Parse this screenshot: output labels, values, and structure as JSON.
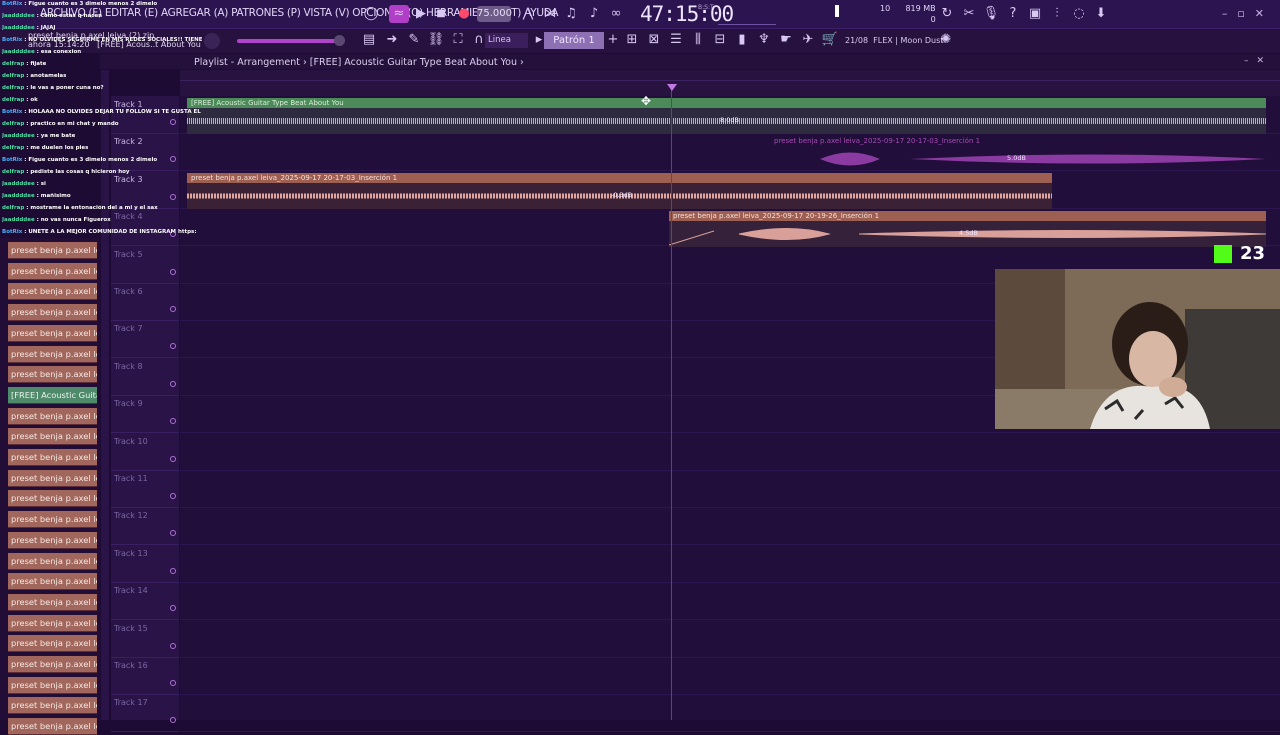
{
  "menu_text": "ARCHIVO (F) EDITAR (E) AGREGAR (A) PATRONES (P) VISTA (V) OPCIONES (O) HERRAMIENTAS (T) AYUDA",
  "tempo": "75.000",
  "time_display": "47:15:00",
  "time_small": "B:S:T",
  "memory": {
    "line1": "10",
    "mb": "819 MB",
    "line2": "0"
  },
  "file_info": {
    "name": "preset benja p.axel leiva (2).zip",
    "time": "ahora 15:14:20",
    "label": "[FREE] Acous..t About You"
  },
  "snap_mode": "Linea",
  "pattern": "Patrón 1",
  "plugin_info": {
    "num": "21/08",
    "name": "FLEX | Moon Dust"
  },
  "playlist_title": "Playlist - Arrangement",
  "playlist_song": "[FREE] Acoustic Guitar Type Beat About You",
  "chat": [
    {
      "user": "BotRix",
      "bot": true,
      "text": "Figue cuanto es 3 dimelo menos 2 dimelo"
    },
    {
      "user": "Jaaddddee",
      "bot": false,
      "text": "como estas q hacen"
    },
    {
      "user": "Jaaddddee",
      "bot": false,
      "text": "JAJAJ"
    },
    {
      "user": "BotRix",
      "bot": true,
      "text": "NO OLVIDES SEGUIRME EN MIS REDES SOCIALES!! TIENE"
    },
    {
      "user": "Jaaddddee",
      "bot": false,
      "text": "esa conexion"
    },
    {
      "user": "delfrap",
      "bot": false,
      "text": "fijate"
    },
    {
      "user": "delfrap",
      "bot": false,
      "text": "anotamelas"
    },
    {
      "user": "delfrap",
      "bot": false,
      "text": "le vas a poner cuna no?"
    },
    {
      "user": "delfrap",
      "bot": false,
      "text": "ok"
    },
    {
      "user": "BotRix",
      "bot": true,
      "text": "HOLAAA NO OLVIDES DEJAR TU FOLLOW SI TE GUSTA EL"
    },
    {
      "user": "delfrap",
      "bot": false,
      "text": "practico en mi chat y mando"
    },
    {
      "user": "Jaaddddee",
      "bot": false,
      "text": "ya me bate"
    },
    {
      "user": "delfrap",
      "bot": false,
      "text": "me duelen los pies"
    },
    {
      "user": "BotRix",
      "bot": true,
      "text": "Figue cuanto es 3 dimelo menos 2 dimelo"
    },
    {
      "user": "delfrap",
      "bot": false,
      "text": "pediste las cosas q hicieron hoy"
    },
    {
      "user": "Jaaddddee",
      "bot": false,
      "text": "si"
    },
    {
      "user": "Jaaddddee",
      "bot": false,
      "text": "mañisimo"
    },
    {
      "user": "delfrap",
      "bot": false,
      "text": "mostrame la entonación del a mi y el sax"
    },
    {
      "user": "Jaaddddee",
      "bot": false,
      "text": "no vas nunca Figuerox"
    },
    {
      "user": "BotRix",
      "bot": true,
      "text": "UNETE A LA MEJOR COMUNIDAD DE INSTAGRAM https:"
    }
  ],
  "browser_items": [
    "preset benja p.axel leiva_",
    "preset benja p.axel leiva_",
    "preset benja p.axel leiva_",
    "preset benja p.axel leiva_",
    "preset benja p.axel leiva_",
    "preset benja p.axel leiva_",
    "preset benja p.axel leiva_",
    "[FREE] Acoustic Guita...",
    "preset benja p.axel leiva_",
    "preset benja p.axel leiva_",
    "preset benja p.axel leiva_",
    "preset benja p.axel leiva_",
    "preset benja p.axel leiva_",
    "preset benja p.axel leiva_",
    "preset benja p.axel leiva_",
    "preset benja p.axel leiva_",
    "preset benja p.axel leiva_",
    "preset benja p.axel leiva_",
    "preset benja p.axel leiva_",
    "preset benja p.axel leiva_",
    "preset benja p.axel leiva_",
    "preset benja p.axel leiva_",
    "preset benja p.axel leiva_",
    "preset benja p.axel leiva_"
  ],
  "selected_browser_index": 7,
  "tracks": [
    "Track 1",
    "Track 2",
    "Track 3",
    "Track 4",
    "Track 5",
    "Track 6",
    "Track 7",
    "Track 8",
    "Track 9",
    "Track 10",
    "Track 11",
    "Track 12",
    "Track 13",
    "Track 14",
    "Track 15",
    "Track 16",
    "Track 17"
  ],
  "clips": {
    "c1": {
      "name": "[FREE] Acoustic Guitar Type Beat About You",
      "db": "8.0dB"
    },
    "c2": {
      "name": "preset benja p.axel leiva_2025-09-17 20-17-03_Inserción 1",
      "db": "5.0dB"
    },
    "c3": {
      "name": "preset benja p.axel leiva_2025-09-17 20-17-03_Inserción 1",
      "db": "-0.3dB"
    },
    "c4": {
      "name": "preset benja p.axel leiva_2025-09-17 20-19-26_Inserción 1",
      "db": "4.5dB"
    }
  },
  "viewer_count": "23",
  "colors": {
    "accent": "#b043c9",
    "green_clip": "#4d8a5a",
    "audio_clip": "#9c5f52",
    "kick": "#53fc18"
  }
}
